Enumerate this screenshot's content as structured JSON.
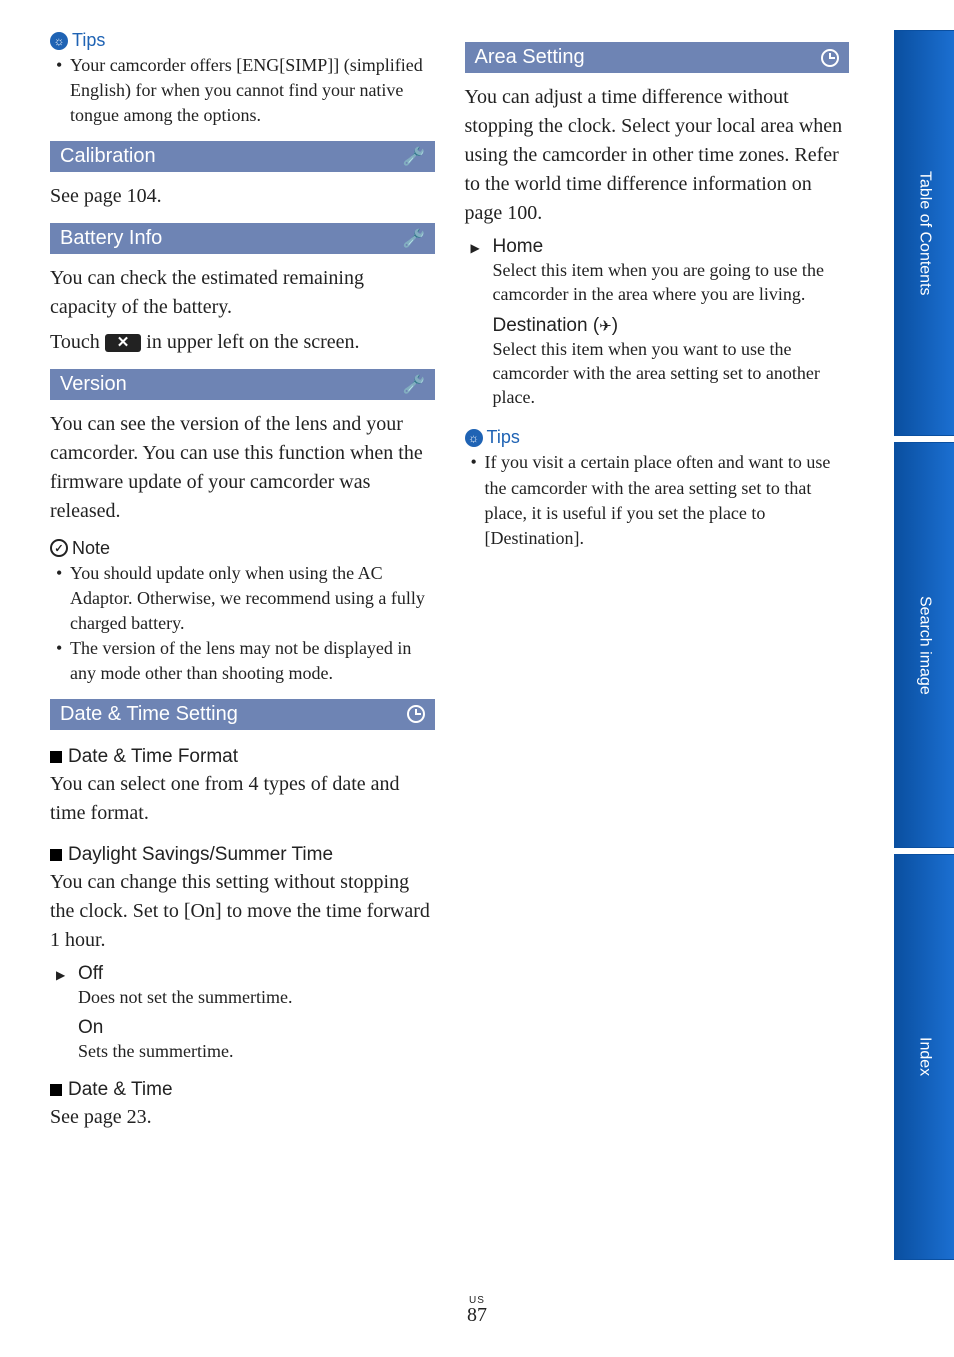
{
  "left": {
    "tips_label": "Tips",
    "tip1": "Your camcorder offers [ENG[SIMP]] (simplified English) for when you cannot find your native tongue among the options.",
    "calibration": {
      "title": "Calibration",
      "body": "See page 104."
    },
    "battery": {
      "title": "Battery Info",
      "body1": "You can check the estimated remaining capacity of the battery.",
      "body2_pre": "Touch ",
      "body2_post": " in upper left on the screen."
    },
    "version": {
      "title": "Version",
      "body": "You can see the version of the lens and your camcorder. You can use this function when the firmware update of your camcorder was released.",
      "note_label": "Note",
      "note1": "You should update only when using the AC Adaptor. Otherwise, we recommend using a fully charged battery.",
      "note2": "The version of the lens may not be displayed in any mode other than shooting mode."
    },
    "datetime": {
      "title": "Date & Time Setting",
      "fmt_title": "Date & Time Format",
      "fmt_body": "You can select one from 4 types of date and time format.",
      "dst_title": "Daylight Savings/Summer Time",
      "dst_body": "You can change this setting without stopping the clock. Set to [On] to move the time forward 1 hour.",
      "off_label": "Off",
      "off_desc": "Does not set the summertime.",
      "on_label": "On",
      "on_desc": "Sets the summertime.",
      "dt_title": "Date & Time",
      "dt_body": "See page 23."
    }
  },
  "right": {
    "area": {
      "title": "Area Setting",
      "body": "You can adjust a time difference without stopping the clock. Select your local area when using the camcorder in other time zones. Refer to the world time difference information on page 100.",
      "home_label": "Home",
      "home_desc": "Select this item when you are going to use the camcorder in the area where you are living.",
      "dest_label": "Destination (",
      "dest_label_post": ")",
      "dest_desc": "Select this item when you want to use the camcorder with the area setting set to another place."
    },
    "tips_label": "Tips",
    "tip1": "If you visit a certain place often and want to use the camcorder with the area setting set to that place, it is useful if you set the place to [Destination]."
  },
  "tabs": {
    "toc": "Table of Contents",
    "search": "Search image",
    "index": "Index"
  },
  "footer": {
    "region": "US",
    "page": "87"
  }
}
